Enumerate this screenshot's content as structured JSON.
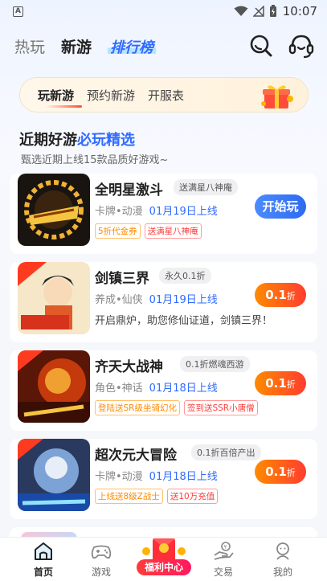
{
  "status_bar": {
    "time": "10:07",
    "a_icon": "A"
  },
  "top_tabs": [
    {
      "label": "热玩"
    },
    {
      "label": "新游"
    },
    {
      "label": "排行榜"
    }
  ],
  "sub_tabs": [
    {
      "label": "玩新游"
    },
    {
      "label": "预约新游"
    },
    {
      "label": "开服表"
    }
  ],
  "section": {
    "title_a": "近期好游",
    "title_b": "必玩精选",
    "subtitle": "甄选近期上线15款品质好游戏~"
  },
  "games": [
    {
      "name": "全明星激斗",
      "badge": "送满星八神庵",
      "category": "卡牌•动漫",
      "date": "01月19日上线",
      "tags": [
        {
          "text": "5折代金券",
          "color": "orange"
        },
        {
          "text": "送满星八神庵",
          "color": "red"
        }
      ],
      "button": "开始玩",
      "button_style": "blue"
    },
    {
      "name": "剑镇三界",
      "badge": "永久0.1折",
      "category": "养成•仙侠",
      "date": "01月19日上线",
      "desc": "开启鼎炉，助您修仙证道，剑镇三界！",
      "button_num": "0.1",
      "button_unit": "折",
      "button_style": "orange"
    },
    {
      "name": "齐天大战神",
      "badge": "0.1折燃魂西游",
      "category": "角色•神话",
      "date": "01月18日上线",
      "tags": [
        {
          "text": "登陆送SR级坐骑幻化",
          "color": "orange"
        },
        {
          "text": "签到送SSR小唐僧",
          "color": "red"
        }
      ],
      "button_num": "0.1",
      "button_unit": "折",
      "button_style": "orange"
    },
    {
      "name": "超次元大冒险",
      "badge": "0.1折百倍产出",
      "category": "卡牌•动漫",
      "date": "01月18日上线",
      "tags": [
        {
          "text": "上线送8级Z战士",
          "color": "orange"
        },
        {
          "text": "送10万充值",
          "color": "red"
        }
      ],
      "button_num": "0.1",
      "button_unit": "折",
      "button_style": "orange"
    }
  ],
  "bottom_nav": [
    {
      "label": "首页",
      "icon": "home-icon"
    },
    {
      "label": "游戏",
      "icon": "gamepad-icon"
    },
    {
      "label": "福利中心",
      "icon": "gift-icon"
    },
    {
      "label": "交易",
      "icon": "trade-icon"
    },
    {
      "label": "我的",
      "icon": "profile-icon"
    }
  ],
  "colors": {
    "accent_blue": "#2f6bff",
    "accent_orange": "#ff5a1f",
    "tag_orange": "#ff8a00",
    "tag_red": "#ff3b3b"
  }
}
